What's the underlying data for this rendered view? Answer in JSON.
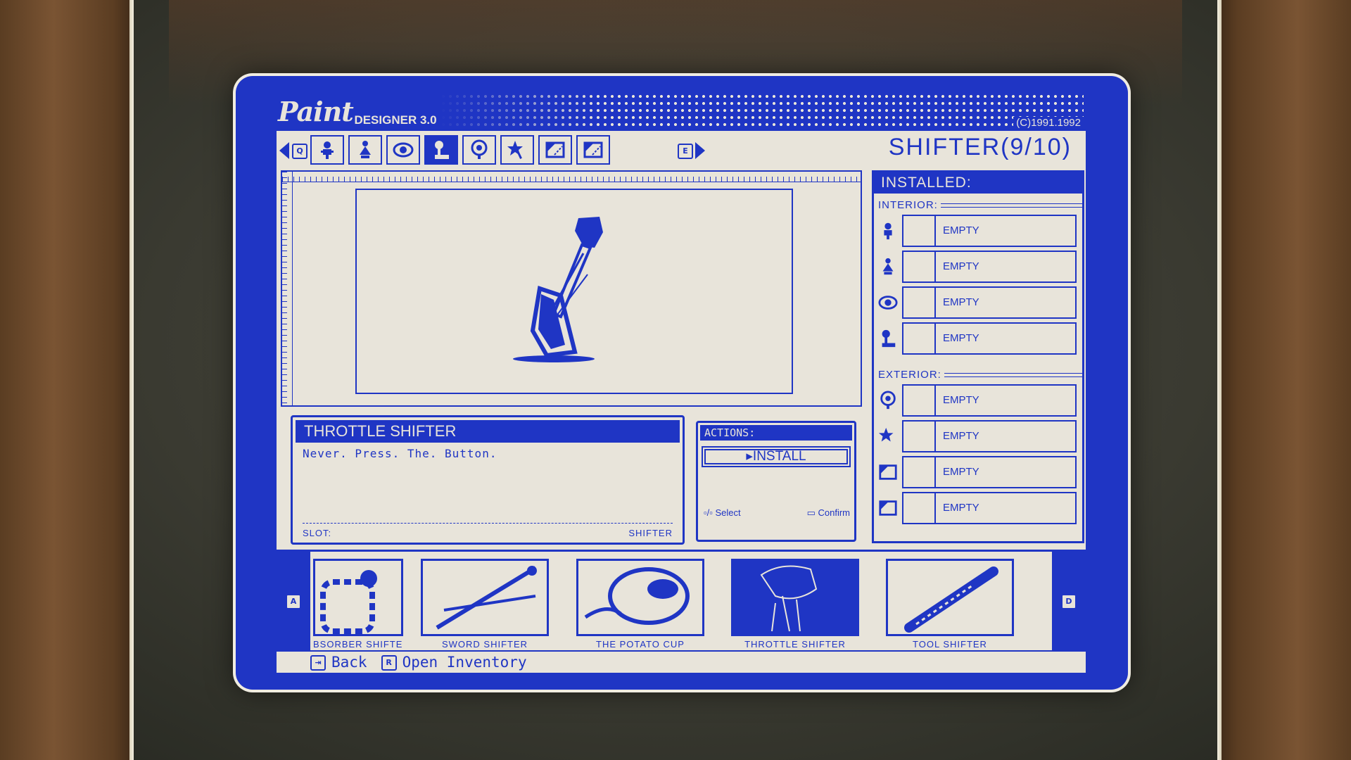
{
  "app": {
    "logo_script": "Paint",
    "logo_sub": "DESIGNER 3.0",
    "copyright": "(C)1991.1992"
  },
  "toolbar": {
    "prev_key": "Q",
    "next_key": "E",
    "tools": [
      {
        "icon": "seat-icon",
        "active": false
      },
      {
        "icon": "figure-icon",
        "active": false
      },
      {
        "icon": "eye-icon",
        "active": false
      },
      {
        "icon": "shifter-icon",
        "active": true
      },
      {
        "icon": "mirror-icon",
        "active": false
      },
      {
        "icon": "ornament-icon",
        "active": false
      },
      {
        "icon": "decal-icon",
        "active": false
      },
      {
        "icon": "decal-icon",
        "active": false
      }
    ],
    "section_title": "SHIFTER(9/10)"
  },
  "item": {
    "name": "THROTTLE SHIFTER",
    "description": "Never. Press. The. Button.",
    "slot_label": "SLOT:",
    "slot_value": "SHIFTER"
  },
  "actions": {
    "title": "ACTIONS:",
    "install_label": "▸INSTALL",
    "hint_select": "Select",
    "hint_confirm": "Confirm"
  },
  "installed": {
    "title": "INSTALLED:",
    "interior_label": "INTERIOR:",
    "exterior_label": "EXTERIOR:",
    "interior": [
      {
        "icon": "seat-icon",
        "label": "EMPTY"
      },
      {
        "icon": "figure-icon",
        "label": "EMPTY"
      },
      {
        "icon": "eye-icon",
        "label": "EMPTY"
      },
      {
        "icon": "shifter-icon",
        "label": "EMPTY"
      }
    ],
    "exterior": [
      {
        "icon": "mirror-icon",
        "label": "EMPTY"
      },
      {
        "icon": "ornament-icon",
        "label": "EMPTY"
      },
      {
        "icon": "decal-icon",
        "label": "EMPTY"
      },
      {
        "icon": "decal-icon",
        "label": "EMPTY"
      }
    ]
  },
  "carousel": {
    "left_key": "A",
    "right_key": "D",
    "items": [
      {
        "label": "BSORBER SHIFTER",
        "active": false
      },
      {
        "label": "SWORD SHIFTER",
        "active": false
      },
      {
        "label": "THE POTATO CUP",
        "active": false
      },
      {
        "label": "THROTTLE SHIFTER",
        "active": true
      },
      {
        "label": "TOOL SHIFTER",
        "active": false
      }
    ]
  },
  "footer": {
    "back_key": "⇥",
    "back_label": "Back",
    "inventory_key": "R",
    "inventory_label": "Open Inventory"
  },
  "colors": {
    "screen_blue": "#1f35c4",
    "paper": "#e8e4da"
  }
}
